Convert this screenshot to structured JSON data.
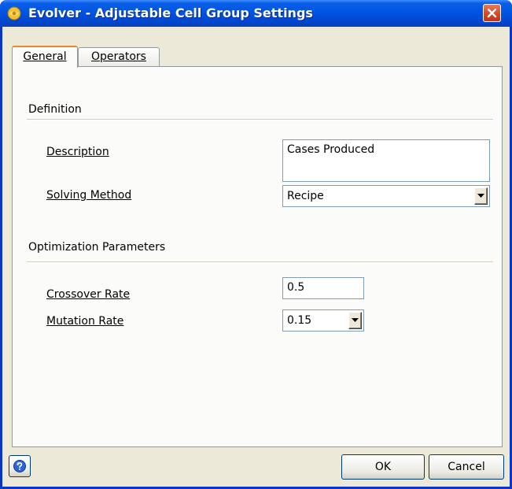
{
  "window": {
    "title": "Evolver - Adjustable Cell Group Settings"
  },
  "tabs": [
    {
      "label": "General",
      "active": true
    },
    {
      "label": "Operators",
      "active": false
    }
  ],
  "definition": {
    "section_label": "Definition",
    "description": {
      "label": "Description",
      "value": "Cases Produced"
    },
    "solving_method": {
      "label": "Solving Method",
      "value": "Recipe"
    }
  },
  "optimization": {
    "section_label": "Optimization Parameters",
    "crossover_rate": {
      "label": "Crossover Rate",
      "value": "0.5"
    },
    "mutation_rate": {
      "label": "Mutation Rate",
      "value": "0.15"
    }
  },
  "buttons": {
    "ok": "OK",
    "cancel": "Cancel"
  },
  "icons": {
    "app": "evolver-app-icon",
    "close": "close-icon",
    "help": "help-icon",
    "dropdown": "chevron-down-icon"
  },
  "colors": {
    "titlebar": "#0054e3",
    "window_bg": "#ece9d8",
    "panel_bg": "#fbfbf9",
    "tab_accent": "#e68b2c",
    "close_button": "#d64322"
  }
}
